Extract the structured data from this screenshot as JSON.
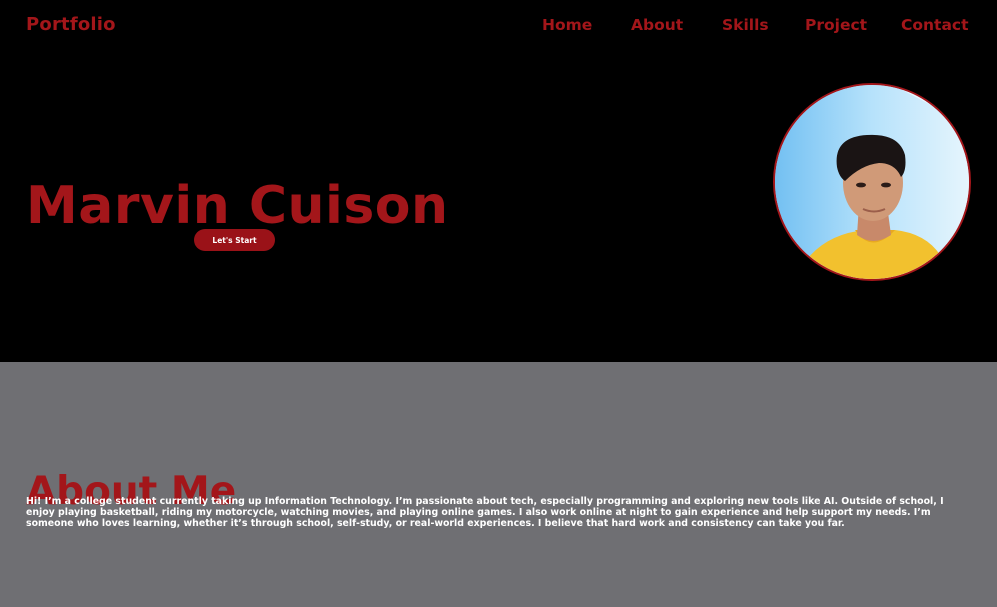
{
  "header": {
    "logo": "Portfolio",
    "nav": [
      {
        "label": "Home"
      },
      {
        "label": "About"
      },
      {
        "label": "Skills"
      },
      {
        "label": "Project"
      },
      {
        "label": "Contact"
      }
    ]
  },
  "hero": {
    "name": "Marvin Cuison",
    "cta_label": "Let's Start"
  },
  "about": {
    "title": "About Me",
    "text": "Hi! I’m a college student currently taking up Information Technology. I’m passionate about tech, especially programming and exploring new tools like AI. Outside of school, I enjoy playing basketball, riding my motorcycle, watching movies, and playing online games. I also work online at night to gain experience and help support my needs. I’m someone who loves learning, whether it’s through school, self-study, or real-world experiences. I believe that hard work and consistency can take you far."
  },
  "colors": {
    "accent": "#a3161a",
    "hero_background": "#000000",
    "about_background": "#6f6f73",
    "button_background": "#9a1218"
  }
}
